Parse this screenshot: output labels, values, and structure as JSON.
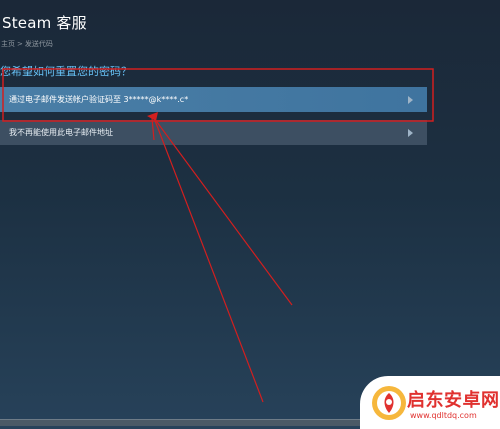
{
  "header": {
    "title": "Steam 客服"
  },
  "breadcrumb": {
    "home": "主页",
    "separator": ">",
    "current": "发送代码"
  },
  "question": "您希望如何重置您的密码？",
  "options": [
    {
      "label": "通过电子邮件发送帐户验证码至 3*****@k****.c*"
    },
    {
      "label": "我不再能使用此电子邮件地址"
    }
  ],
  "watermark": {
    "text": "启东安卓网",
    "url": "www.qdltdq.com"
  },
  "colors": {
    "background": "#1b2838",
    "accent_blue": "#67c1f5",
    "selected_option": "#4a7ea6",
    "option": "#3d4f62",
    "annotation_red": "#d21f1f",
    "watermark_red": "#e0312f"
  }
}
